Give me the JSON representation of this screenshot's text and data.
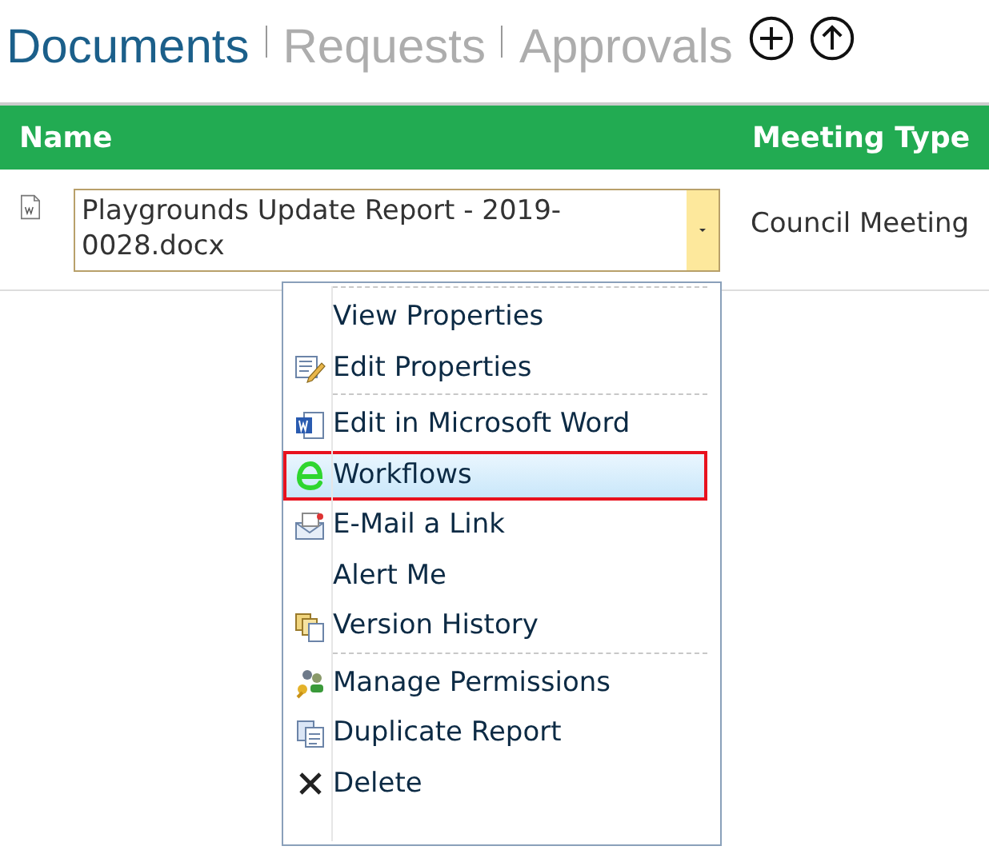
{
  "tabs": [
    {
      "label": "Documents",
      "selected": true
    },
    {
      "label": "Requests",
      "selected": false
    },
    {
      "label": "Approvals",
      "selected": false
    }
  ],
  "table": {
    "columns": [
      "Name",
      "Meeting Type"
    ],
    "rows": [
      {
        "name": "Playgrounds Update Report - 2019-0028.docx",
        "meeting_type": "Council Meeting"
      }
    ]
  },
  "context_menu": {
    "groups": [
      [
        {
          "label": "View Properties",
          "selected": false
        },
        {
          "label": "Edit Properties",
          "selected": false
        }
      ],
      [
        {
          "label": "Edit in Microsoft Word",
          "selected": false
        },
        {
          "label": "Workflows",
          "selected": true
        },
        {
          "label": "E-Mail a Link",
          "selected": false
        },
        {
          "label": "Alert Me",
          "selected": false
        },
        {
          "label": "Version History",
          "selected": false
        }
      ],
      [
        {
          "label": "Manage Permissions",
          "selected": false
        },
        {
          "label": "Duplicate Report",
          "selected": false
        },
        {
          "label": "Delete",
          "selected": false
        }
      ]
    ]
  }
}
